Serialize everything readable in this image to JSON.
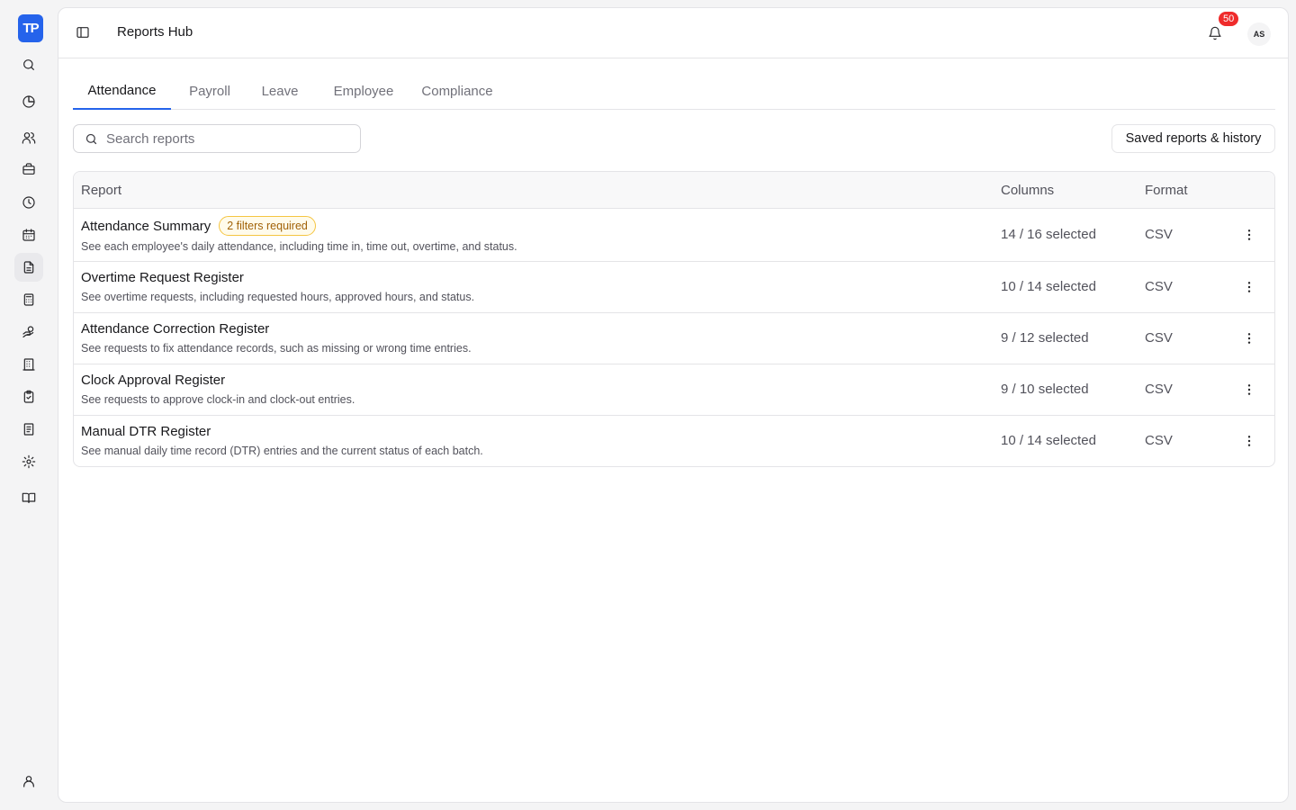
{
  "app": {
    "logo_text": "TP",
    "page_title": "Reports Hub"
  },
  "sidebar": {
    "items": [
      {
        "icon": "search-icon"
      },
      {
        "icon": "chart-pie-icon"
      },
      {
        "icon": "users-icon"
      },
      {
        "icon": "briefcase-icon"
      },
      {
        "icon": "clock-icon"
      },
      {
        "icon": "calendar-icon"
      },
      {
        "icon": "file-text-icon",
        "active": true
      },
      {
        "icon": "calculator-icon"
      },
      {
        "icon": "hand-coins-icon"
      },
      {
        "icon": "building-icon"
      },
      {
        "icon": "clipboard-check-icon"
      },
      {
        "icon": "notebook-icon"
      },
      {
        "icon": "gear-icon"
      },
      {
        "icon": "book-open-icon"
      },
      {
        "icon": "user-icon"
      }
    ]
  },
  "header": {
    "notifications_count": "50",
    "avatar_initials": "AS"
  },
  "tabs": [
    {
      "label": "Attendance",
      "active": true
    },
    {
      "label": "Payroll"
    },
    {
      "label": "Leave"
    },
    {
      "label": "Employee"
    },
    {
      "label": "Compliance"
    }
  ],
  "search": {
    "placeholder": "Search reports",
    "value": ""
  },
  "saved_button_label": "Saved reports & history",
  "table": {
    "headers": {
      "report": "Report",
      "columns": "Columns",
      "format": "Format"
    },
    "rows": [
      {
        "name": "Attendance Summary",
        "badge": "2 filters required",
        "description": "See each employee's daily attendance, including time in, time out, overtime, and status.",
        "columns": "14 / 16 selected",
        "format": "CSV"
      },
      {
        "name": "Overtime Request Register",
        "description": "See overtime requests, including requested hours, approved hours, and status.",
        "columns": "10 / 14 selected",
        "format": "CSV"
      },
      {
        "name": "Attendance Correction Register",
        "description": "See requests to fix attendance records, such as missing or wrong time entries.",
        "columns": "9 / 12 selected",
        "format": "CSV"
      },
      {
        "name": "Clock Approval Register",
        "description": "See requests to approve clock-in and clock-out entries.",
        "columns": "9 / 10 selected",
        "format": "CSV"
      },
      {
        "name": "Manual DTR Register",
        "description": "See manual daily time record (DTR) entries and the current status of each batch.",
        "columns": "10 / 14 selected",
        "format": "CSV"
      }
    ]
  },
  "colors": {
    "accent": "#2563eb",
    "badge_border": "#f5c542",
    "notification": "#ef2b2b"
  }
}
